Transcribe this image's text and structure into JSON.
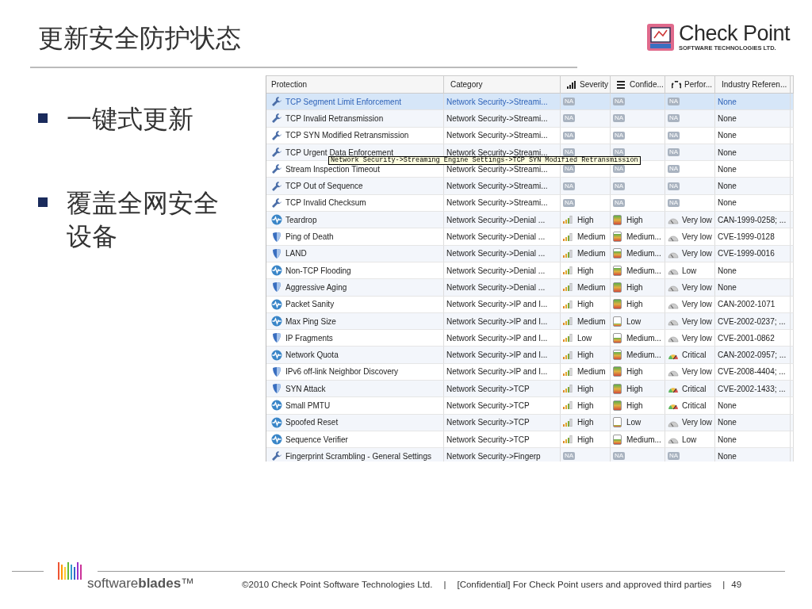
{
  "slide": {
    "title": "更新安全防护状态",
    "bullets": [
      "一键式更新",
      "覆盖全网安全设备"
    ]
  },
  "logo": {
    "name": "Check Point",
    "tagline": "SOFTWARE TECHNOLOGIES LTD."
  },
  "table": {
    "columns": [
      "Protection",
      "Category",
      "Severity",
      "Confide...",
      "Perfor...",
      "Industry Referen..."
    ],
    "rows": [
      {
        "kind": "setting",
        "selected": true,
        "name": "TCP Segment Limit Enforcement",
        "category": "Network Security->Streami...",
        "severity": "NA",
        "confidence": "NA",
        "performance": "NA",
        "reference": "None"
      },
      {
        "kind": "setting",
        "selected": false,
        "name": "TCP Invalid Retransmission",
        "category": "Network Security->Streami...",
        "severity": "NA",
        "confidence": "NA",
        "performance": "NA",
        "reference": "None"
      },
      {
        "kind": "setting",
        "selected": false,
        "name": "TCP SYN Modified Retransmission",
        "category": "Network Security->Streami...",
        "severity": "NA",
        "confidence": "NA",
        "performance": "NA",
        "reference": "None"
      },
      {
        "kind": "setting",
        "selected": false,
        "name": "TCP Urgent Data Enforcement",
        "category": "Network Security->Streami...",
        "severity": "NA",
        "confidence": "NA",
        "performance": "NA",
        "reference": "None"
      },
      {
        "kind": "setting",
        "selected": false,
        "name": "Stream Inspection Timeout",
        "category": "Network Security->Streami...",
        "severity": "NA",
        "confidence": "NA",
        "performance": "NA",
        "reference": "None"
      },
      {
        "kind": "setting",
        "selected": false,
        "name": "TCP Out of Sequence",
        "category": "Network Security->Streami...",
        "severity": "NA",
        "confidence": "NA",
        "performance": "NA",
        "reference": "None"
      },
      {
        "kind": "setting",
        "selected": false,
        "name": "TCP Invalid Checksum",
        "category": "Network Security->Streami...",
        "severity": "NA",
        "confidence": "NA",
        "performance": "NA",
        "reference": "None"
      },
      {
        "kind": "pulse",
        "selected": false,
        "name": "Teardrop",
        "category": "Network Security->Denial ...",
        "severity": "High",
        "confidence": {
          "text": "High",
          "level": 1
        },
        "performance": {
          "text": "Very low",
          "alert": false
        },
        "reference": "CAN-1999-0258; ..."
      },
      {
        "kind": "shield",
        "selected": false,
        "name": "Ping of Death",
        "category": "Network Security->Denial ...",
        "severity": "Medium",
        "confidence": {
          "text": "Medium...",
          "level": 0.8
        },
        "performance": {
          "text": "Very low",
          "alert": false
        },
        "reference": "CVE-1999-0128"
      },
      {
        "kind": "shield",
        "selected": false,
        "name": "LAND",
        "category": "Network Security->Denial ...",
        "severity": "Medium",
        "confidence": {
          "text": "Medium...",
          "level": 0.8
        },
        "performance": {
          "text": "Very low",
          "alert": false
        },
        "reference": "CVE-1999-0016"
      },
      {
        "kind": "pulse",
        "selected": false,
        "name": "Non-TCP Flooding",
        "category": "Network Security->Denial ...",
        "severity": "High",
        "confidence": {
          "text": "Medium...",
          "level": 0.8
        },
        "performance": {
          "text": "Low",
          "alert": false
        },
        "reference": "None"
      },
      {
        "kind": "shield",
        "selected": false,
        "name": "Aggressive Aging",
        "category": "Network Security->Denial ...",
        "severity": "Medium",
        "confidence": {
          "text": "High",
          "level": 1
        },
        "performance": {
          "text": "Very low",
          "alert": false
        },
        "reference": "None"
      },
      {
        "kind": "pulse",
        "selected": false,
        "name": "Packet Sanity",
        "category": "Network Security->IP and I...",
        "severity": "High",
        "confidence": {
          "text": "High",
          "level": 1
        },
        "performance": {
          "text": "Very low",
          "alert": false
        },
        "reference": "CAN-2002-1071"
      },
      {
        "kind": "pulse",
        "selected": false,
        "name": "Max Ping Size",
        "category": "Network Security->IP and I...",
        "severity": "Medium",
        "confidence": {
          "text": "Low",
          "level": 0.2
        },
        "performance": {
          "text": "Very low",
          "alert": false
        },
        "reference": "CVE-2002-0237; ..."
      },
      {
        "kind": "shield",
        "selected": false,
        "name": "IP Fragments",
        "category": "Network Security->IP and I...",
        "severity": "Low",
        "confidence": {
          "text": "Medium...",
          "level": 0.5
        },
        "performance": {
          "text": "Very low",
          "alert": false
        },
        "reference": "CVE-2001-0862"
      },
      {
        "kind": "pulse",
        "selected": false,
        "name": "Network Quota",
        "category": "Network Security->IP and I...",
        "severity": "High",
        "confidence": {
          "text": "Medium...",
          "level": 0.8
        },
        "performance": {
          "text": "Critical",
          "alert": true
        },
        "reference": "CAN-2002-0957; ..."
      },
      {
        "kind": "shield",
        "selected": false,
        "name": "IPv6 off-link Neighbor Discovery",
        "category": "Network Security->IP and I...",
        "severity": "Medium",
        "confidence": {
          "text": "High",
          "level": 1
        },
        "performance": {
          "text": "Very low",
          "alert": false
        },
        "reference": "CVE-2008-4404; ..."
      },
      {
        "kind": "shield",
        "selected": false,
        "name": "SYN Attack",
        "category": "Network Security->TCP",
        "severity": "High",
        "confidence": {
          "text": "High",
          "level": 1
        },
        "performance": {
          "text": "Critical",
          "alert": true
        },
        "reference": "CVE-2002-1433; ..."
      },
      {
        "kind": "pulse",
        "selected": false,
        "name": "Small PMTU",
        "category": "Network Security->TCP",
        "severity": "High",
        "confidence": {
          "text": "High",
          "level": 1
        },
        "performance": {
          "text": "Critical",
          "alert": true
        },
        "reference": "None"
      },
      {
        "kind": "pulse",
        "selected": false,
        "name": "Spoofed Reset",
        "category": "Network Security->TCP",
        "severity": "High",
        "confidence": {
          "text": "Low",
          "level": 0.2
        },
        "performance": {
          "text": "Very low",
          "alert": false
        },
        "reference": "None"
      },
      {
        "kind": "pulse",
        "selected": false,
        "name": "Sequence Verifier",
        "category": "Network Security->TCP",
        "severity": "High",
        "confidence": {
          "text": "Medium...",
          "level": 0.5
        },
        "performance": {
          "text": "Low",
          "alert": false
        },
        "reference": "None"
      },
      {
        "kind": "setting",
        "selected": false,
        "name": "Fingerprint Scrambling - General Settings",
        "category": "Network Security->Fingerp",
        "severity": "NA",
        "confidence": "NA",
        "performance": "NA",
        "reference": "None"
      }
    ],
    "tooltip": "Network Security->Streaming Engine Settings->TCP SYN Modified Retransmission"
  },
  "footer": {
    "brand": "software**blades**™",
    "copyright": "©2010 Check Point Software Technologies Ltd.",
    "separator_1": "|",
    "notice": "[Confidential] For Check Point users and approved third parties",
    "separator_2": "|",
    "page": "49"
  }
}
